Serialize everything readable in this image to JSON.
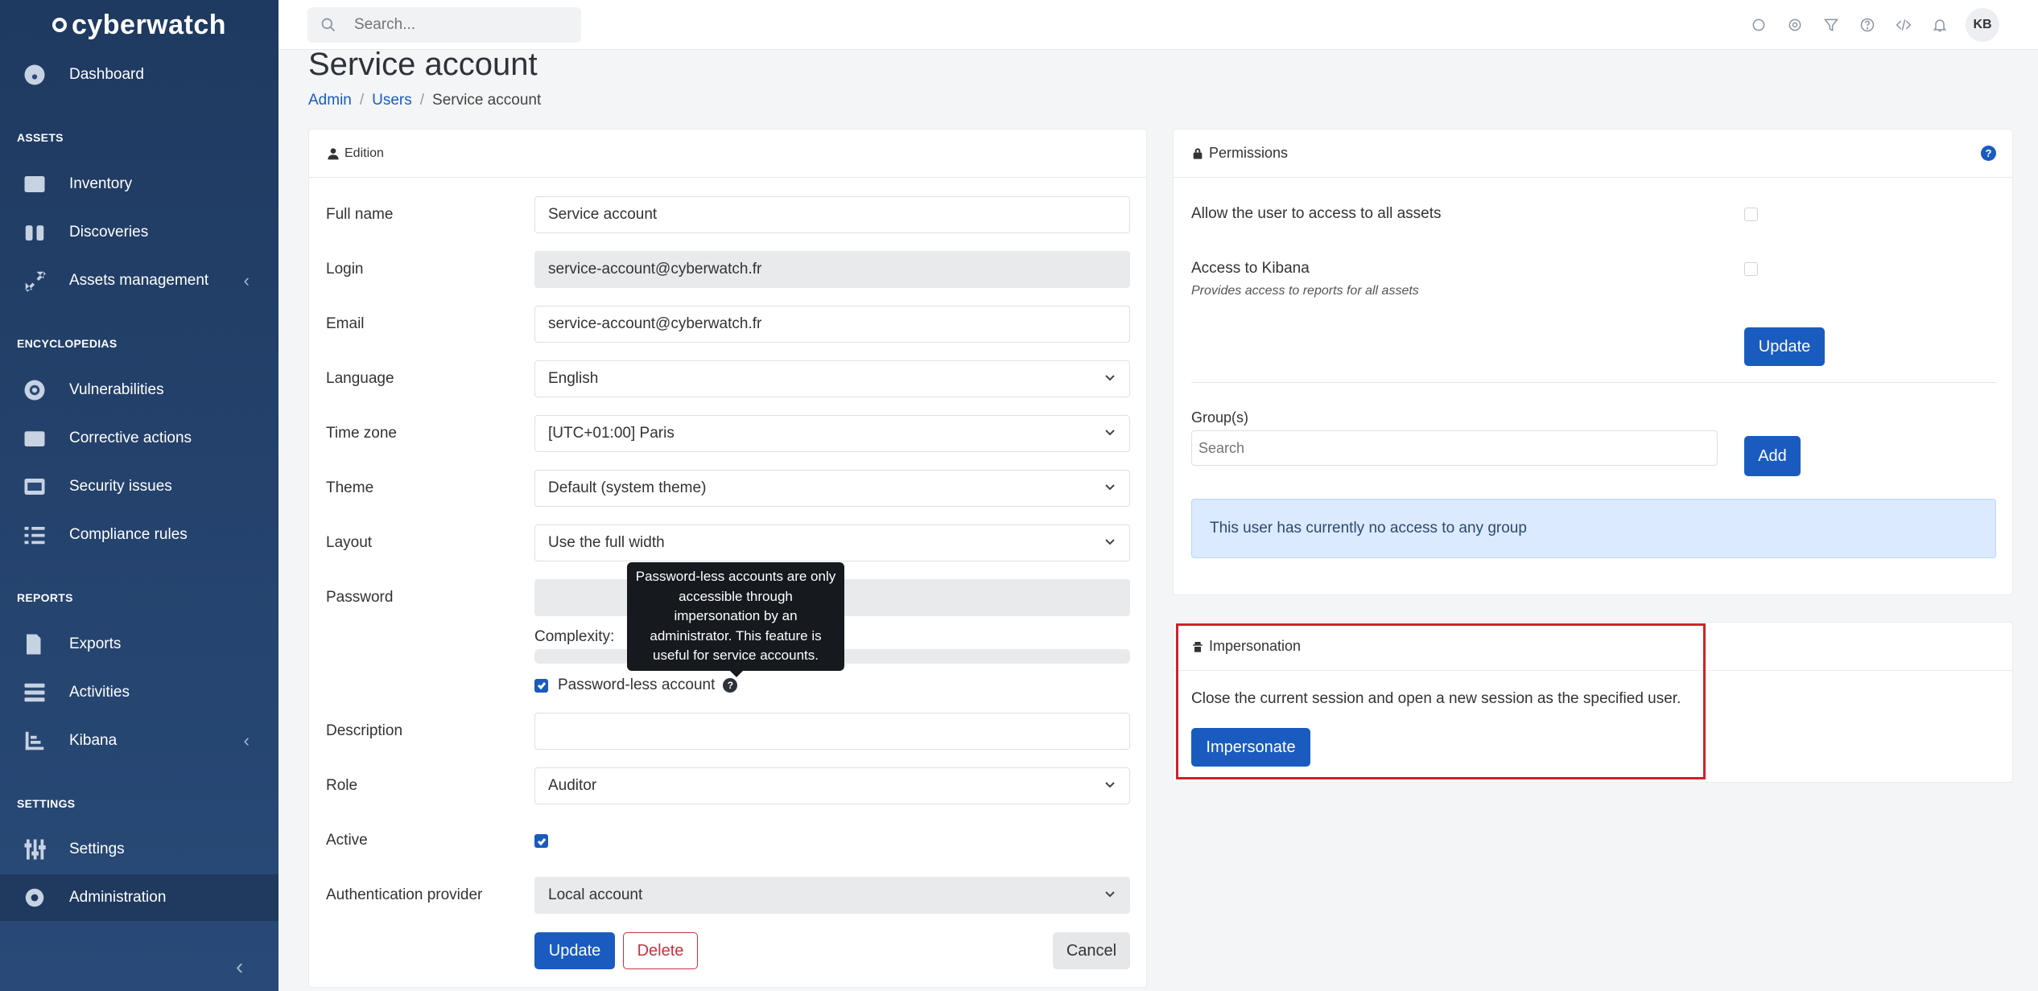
{
  "sidebar": {
    "brand": "cyberwatch",
    "sections": {
      "assets": "ASSETS",
      "encyclopedias": "ENCYCLOPEDIAS",
      "reports": "REPORTS",
      "settings": "SETTINGS"
    },
    "items": [
      {
        "label": "Dashboard",
        "icon": "dashboard-icon"
      },
      {
        "label": "Inventory",
        "icon": "list-icon"
      },
      {
        "label": "Discoveries",
        "icon": "binoculars-icon"
      },
      {
        "label": "Assets management",
        "icon": "expand-icon"
      },
      {
        "label": "Vulnerabilities",
        "icon": "target-icon"
      },
      {
        "label": "Corrective actions",
        "icon": "box-icon"
      },
      {
        "label": "Security issues",
        "icon": "terminal-icon"
      },
      {
        "label": "Compliance rules",
        "icon": "checklist-icon"
      },
      {
        "label": "Exports",
        "icon": "file-export-icon"
      },
      {
        "label": "Activities",
        "icon": "activity-list-icon"
      },
      {
        "label": "Kibana",
        "icon": "chart-icon"
      },
      {
        "label": "Settings",
        "icon": "sliders-icon"
      },
      {
        "label": "Administration",
        "icon": "gear-icon"
      }
    ]
  },
  "topbar": {
    "search_placeholder": "Search...",
    "avatar": "KB"
  },
  "header": {
    "title": "Service account",
    "breadcrumb": [
      "Admin",
      "Users",
      "Service account"
    ]
  },
  "edition": {
    "title": "Edition",
    "full_name_label": "Full name",
    "full_name_value": "Service account",
    "login_label": "Login",
    "login_value": "service-account@cyberwatch.fr",
    "email_label": "Email",
    "email_value": "service-account@cyberwatch.fr",
    "language_label": "Language",
    "language_value": "English",
    "timezone_label": "Time zone",
    "timezone_value": "[UTC+01:00] Paris",
    "theme_label": "Theme",
    "theme_value": "Default (system theme)",
    "layout_label": "Layout",
    "layout_value": "Use the full width",
    "password_label": "Password",
    "complexity_label": "Complexity:",
    "passwordless_label": "Password-less account",
    "tooltip": "Password-less accounts are only accessible through impersonation by an administrator. This feature is useful for service accounts.",
    "description_label": "Description",
    "role_label": "Role",
    "role_value": "Auditor",
    "active_label": "Active",
    "auth_label": "Authentication provider",
    "auth_value": "Local account",
    "update_btn": "Update",
    "delete_btn": "Delete",
    "cancel_btn": "Cancel"
  },
  "permissions": {
    "title": "Permissions",
    "all_assets_label": "Allow the user to access to all assets",
    "kibana_label": "Access to Kibana",
    "kibana_hint": "Provides access to reports for all assets",
    "update_btn": "Update",
    "groups_label": "Group(s)",
    "groups_placeholder": "Search",
    "add_btn": "Add",
    "no_group_info": "This user has currently no access to any group"
  },
  "impersonation": {
    "title": "Impersonation",
    "description": "Close the current session and open a new session as the specified user.",
    "button": "Impersonate"
  },
  "colors": {
    "sidebar": "#1f3a60",
    "primary": "#1a5bbf",
    "danger": "#c8313d",
    "highlight": "#d3202b"
  }
}
